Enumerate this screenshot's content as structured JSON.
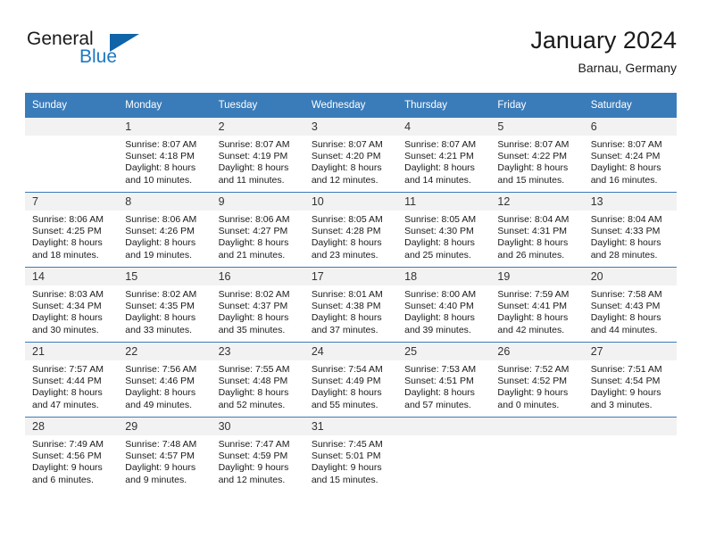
{
  "brand": {
    "name_part1": "General",
    "name_part2": "Blue",
    "accent_color": "#1064a8",
    "blue_text_color": "#1f78c1"
  },
  "header": {
    "title": "January 2024",
    "subtitle": "Barnau, Germany"
  },
  "theme": {
    "header_row_bg": "#3a7cba",
    "daynum_bg": "#f2f2f2",
    "grid_line": "#3a7cba",
    "text": "#1a1a1a"
  },
  "weekday_headers": [
    "Sunday",
    "Monday",
    "Tuesday",
    "Wednesday",
    "Thursday",
    "Friday",
    "Saturday"
  ],
  "weeks": [
    [
      {
        "day": "",
        "empty": true
      },
      {
        "day": "1",
        "sunrise": "Sunrise: 8:07 AM",
        "sunset": "Sunset: 4:18 PM",
        "daylight_line1": "Daylight: 8 hours",
        "daylight_line2": "and 10 minutes."
      },
      {
        "day": "2",
        "sunrise": "Sunrise: 8:07 AM",
        "sunset": "Sunset: 4:19 PM",
        "daylight_line1": "Daylight: 8 hours",
        "daylight_line2": "and 11 minutes."
      },
      {
        "day": "3",
        "sunrise": "Sunrise: 8:07 AM",
        "sunset": "Sunset: 4:20 PM",
        "daylight_line1": "Daylight: 8 hours",
        "daylight_line2": "and 12 minutes."
      },
      {
        "day": "4",
        "sunrise": "Sunrise: 8:07 AM",
        "sunset": "Sunset: 4:21 PM",
        "daylight_line1": "Daylight: 8 hours",
        "daylight_line2": "and 14 minutes."
      },
      {
        "day": "5",
        "sunrise": "Sunrise: 8:07 AM",
        "sunset": "Sunset: 4:22 PM",
        "daylight_line1": "Daylight: 8 hours",
        "daylight_line2": "and 15 minutes."
      },
      {
        "day": "6",
        "sunrise": "Sunrise: 8:07 AM",
        "sunset": "Sunset: 4:24 PM",
        "daylight_line1": "Daylight: 8 hours",
        "daylight_line2": "and 16 minutes."
      }
    ],
    [
      {
        "day": "7",
        "sunrise": "Sunrise: 8:06 AM",
        "sunset": "Sunset: 4:25 PM",
        "daylight_line1": "Daylight: 8 hours",
        "daylight_line2": "and 18 minutes."
      },
      {
        "day": "8",
        "sunrise": "Sunrise: 8:06 AM",
        "sunset": "Sunset: 4:26 PM",
        "daylight_line1": "Daylight: 8 hours",
        "daylight_line2": "and 19 minutes."
      },
      {
        "day": "9",
        "sunrise": "Sunrise: 8:06 AM",
        "sunset": "Sunset: 4:27 PM",
        "daylight_line1": "Daylight: 8 hours",
        "daylight_line2": "and 21 minutes."
      },
      {
        "day": "10",
        "sunrise": "Sunrise: 8:05 AM",
        "sunset": "Sunset: 4:28 PM",
        "daylight_line1": "Daylight: 8 hours",
        "daylight_line2": "and 23 minutes."
      },
      {
        "day": "11",
        "sunrise": "Sunrise: 8:05 AM",
        "sunset": "Sunset: 4:30 PM",
        "daylight_line1": "Daylight: 8 hours",
        "daylight_line2": "and 25 minutes."
      },
      {
        "day": "12",
        "sunrise": "Sunrise: 8:04 AM",
        "sunset": "Sunset: 4:31 PM",
        "daylight_line1": "Daylight: 8 hours",
        "daylight_line2": "and 26 minutes."
      },
      {
        "day": "13",
        "sunrise": "Sunrise: 8:04 AM",
        "sunset": "Sunset: 4:33 PM",
        "daylight_line1": "Daylight: 8 hours",
        "daylight_line2": "and 28 minutes."
      }
    ],
    [
      {
        "day": "14",
        "sunrise": "Sunrise: 8:03 AM",
        "sunset": "Sunset: 4:34 PM",
        "daylight_line1": "Daylight: 8 hours",
        "daylight_line2": "and 30 minutes."
      },
      {
        "day": "15",
        "sunrise": "Sunrise: 8:02 AM",
        "sunset": "Sunset: 4:35 PM",
        "daylight_line1": "Daylight: 8 hours",
        "daylight_line2": "and 33 minutes."
      },
      {
        "day": "16",
        "sunrise": "Sunrise: 8:02 AM",
        "sunset": "Sunset: 4:37 PM",
        "daylight_line1": "Daylight: 8 hours",
        "daylight_line2": "and 35 minutes."
      },
      {
        "day": "17",
        "sunrise": "Sunrise: 8:01 AM",
        "sunset": "Sunset: 4:38 PM",
        "daylight_line1": "Daylight: 8 hours",
        "daylight_line2": "and 37 minutes."
      },
      {
        "day": "18",
        "sunrise": "Sunrise: 8:00 AM",
        "sunset": "Sunset: 4:40 PM",
        "daylight_line1": "Daylight: 8 hours",
        "daylight_line2": "and 39 minutes."
      },
      {
        "day": "19",
        "sunrise": "Sunrise: 7:59 AM",
        "sunset": "Sunset: 4:41 PM",
        "daylight_line1": "Daylight: 8 hours",
        "daylight_line2": "and 42 minutes."
      },
      {
        "day": "20",
        "sunrise": "Sunrise: 7:58 AM",
        "sunset": "Sunset: 4:43 PM",
        "daylight_line1": "Daylight: 8 hours",
        "daylight_line2": "and 44 minutes."
      }
    ],
    [
      {
        "day": "21",
        "sunrise": "Sunrise: 7:57 AM",
        "sunset": "Sunset: 4:44 PM",
        "daylight_line1": "Daylight: 8 hours",
        "daylight_line2": "and 47 minutes."
      },
      {
        "day": "22",
        "sunrise": "Sunrise: 7:56 AM",
        "sunset": "Sunset: 4:46 PM",
        "daylight_line1": "Daylight: 8 hours",
        "daylight_line2": "and 49 minutes."
      },
      {
        "day": "23",
        "sunrise": "Sunrise: 7:55 AM",
        "sunset": "Sunset: 4:48 PM",
        "daylight_line1": "Daylight: 8 hours",
        "daylight_line2": "and 52 minutes."
      },
      {
        "day": "24",
        "sunrise": "Sunrise: 7:54 AM",
        "sunset": "Sunset: 4:49 PM",
        "daylight_line1": "Daylight: 8 hours",
        "daylight_line2": "and 55 minutes."
      },
      {
        "day": "25",
        "sunrise": "Sunrise: 7:53 AM",
        "sunset": "Sunset: 4:51 PM",
        "daylight_line1": "Daylight: 8 hours",
        "daylight_line2": "and 57 minutes."
      },
      {
        "day": "26",
        "sunrise": "Sunrise: 7:52 AM",
        "sunset": "Sunset: 4:52 PM",
        "daylight_line1": "Daylight: 9 hours",
        "daylight_line2": "and 0 minutes."
      },
      {
        "day": "27",
        "sunrise": "Sunrise: 7:51 AM",
        "sunset": "Sunset: 4:54 PM",
        "daylight_line1": "Daylight: 9 hours",
        "daylight_line2": "and 3 minutes."
      }
    ],
    [
      {
        "day": "28",
        "sunrise": "Sunrise: 7:49 AM",
        "sunset": "Sunset: 4:56 PM",
        "daylight_line1": "Daylight: 9 hours",
        "daylight_line2": "and 6 minutes."
      },
      {
        "day": "29",
        "sunrise": "Sunrise: 7:48 AM",
        "sunset": "Sunset: 4:57 PM",
        "daylight_line1": "Daylight: 9 hours",
        "daylight_line2": "and 9 minutes."
      },
      {
        "day": "30",
        "sunrise": "Sunrise: 7:47 AM",
        "sunset": "Sunset: 4:59 PM",
        "daylight_line1": "Daylight: 9 hours",
        "daylight_line2": "and 12 minutes."
      },
      {
        "day": "31",
        "sunrise": "Sunrise: 7:45 AM",
        "sunset": "Sunset: 5:01 PM",
        "daylight_line1": "Daylight: 9 hours",
        "daylight_line2": "and 15 minutes."
      },
      {
        "day": "",
        "empty": true
      },
      {
        "day": "",
        "empty": true
      },
      {
        "day": "",
        "empty": true
      }
    ]
  ]
}
